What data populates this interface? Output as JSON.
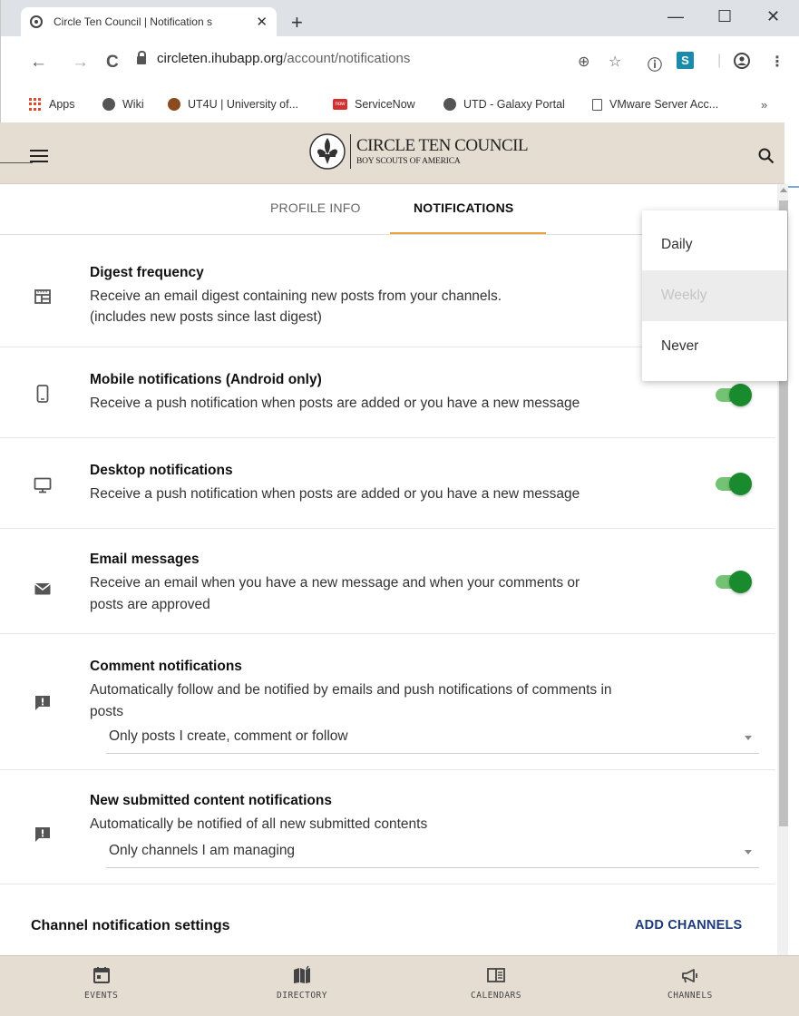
{
  "browser": {
    "tab_title": "Circle Ten Council | Notification s",
    "tab_close": "✕",
    "new_tab": "+",
    "win_minimize": "—",
    "win_maximize": "☐",
    "win_close": "✕",
    "back": "←",
    "forward": "→",
    "reload": "C",
    "url_host": "circleten.ihubapp.org",
    "url_path": "/account/notifications",
    "bookmarks": [
      "Apps",
      "Wiki",
      "UT4U | University of...",
      "ServiceNow",
      "UTD - Galaxy Portal",
      "VMware Server Acc..."
    ],
    "bookmarks_more": "»",
    "ext_s_label": "S"
  },
  "header": {
    "org_name": "CIRCLE TEN COUNCIL",
    "org_sub": "BOY SCOUTS OF AMERICA"
  },
  "tabs": {
    "profile": "PROFILE INFO",
    "notifications": "NOTIFICATIONS"
  },
  "settings": {
    "digest": {
      "title": "Digest frequency",
      "desc1": "Receive an email digest containing new posts from your channels.",
      "desc2": "(includes new posts since last digest)"
    },
    "mobile": {
      "title": "Mobile notifications (Android only)",
      "desc": "Receive a push notification when posts are added or you have a new message",
      "enabled": true
    },
    "desktop": {
      "title": "Desktop notifications",
      "desc": "Receive a push notification when posts are added or you have a new message",
      "enabled": true
    },
    "email": {
      "title": "Email messages",
      "desc1": "Receive an email when you have a new message and when your comments or",
      "desc2": "posts are approved",
      "enabled": true
    },
    "comment": {
      "title": "Comment notifications",
      "desc1": "Automatically follow and be notified by emails and push notifications of comments in",
      "desc2": "posts",
      "selected": "Only posts I create, comment or follow"
    },
    "submitted": {
      "title": "New submitted content notifications",
      "desc": "Automatically be notified of all new submitted contents",
      "selected": "Only channels I am managing"
    }
  },
  "channels": {
    "title": "Channel notification settings",
    "add_label": "ADD CHANNELS"
  },
  "digest_menu": {
    "options": [
      "Daily",
      "Weekly",
      "Never"
    ],
    "selected": "Weekly"
  },
  "bottom_nav": {
    "events": "EVENTS",
    "directory": "DIRECTORY",
    "calendars": "CALENDARS",
    "channels": "CHANNELS"
  },
  "colors": {
    "header_bg": "#e5ddd2",
    "tab_accent": "#e9a53a",
    "toggle_on": "#1a8a2e",
    "link": "#1f3a7a"
  }
}
